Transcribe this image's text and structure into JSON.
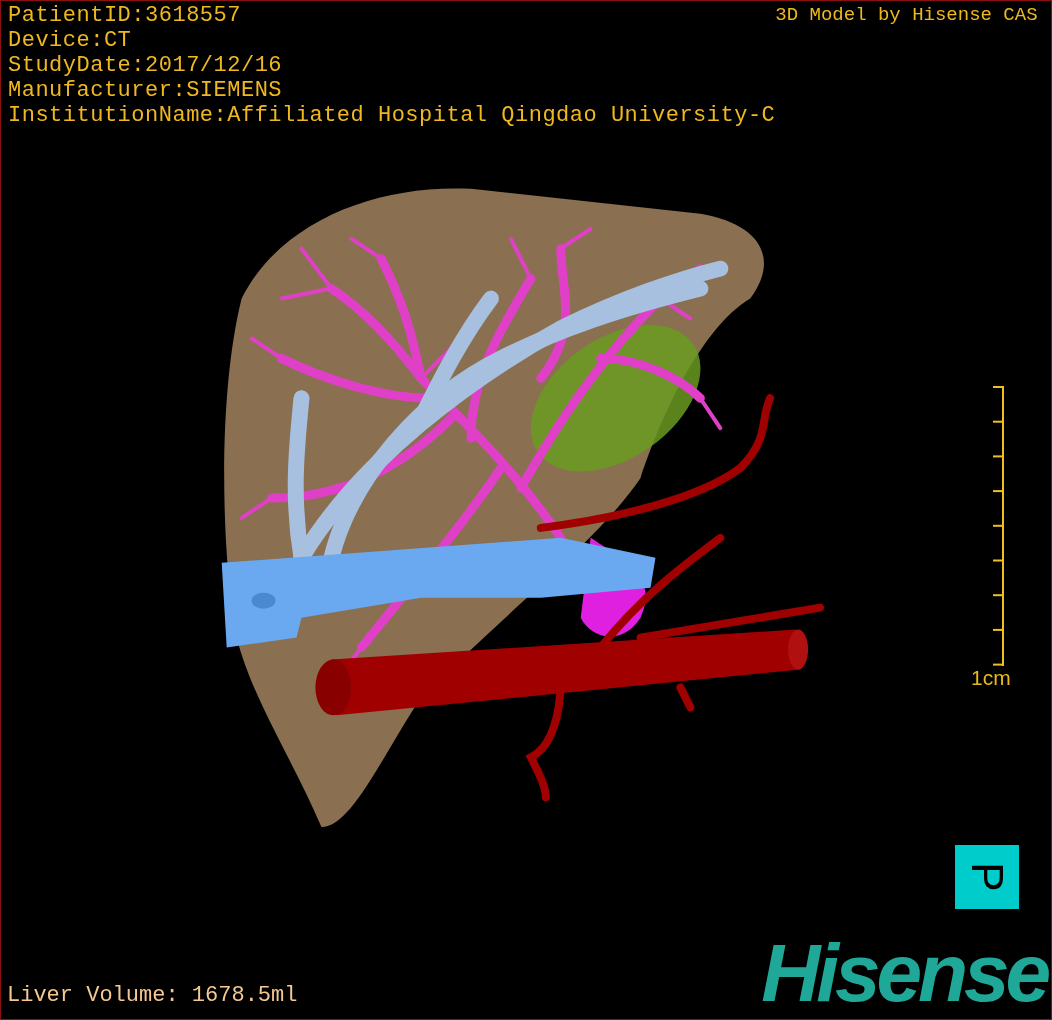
{
  "header": {
    "lines": [
      "PatientID:3618557",
      "Device:CT",
      "StudyDate:2017/12/16",
      "Manufacturer:SIEMENS",
      "InstitutionName:Affiliated Hospital Qingdao University-C"
    ],
    "credit": "3D Model by Hisense CAS"
  },
  "scale_bar": {
    "label": "1cm"
  },
  "orientation_marker": {
    "label": "P"
  },
  "footer": {
    "measurement": "Liver Volume: 1678.5ml",
    "logo": "Hisense"
  }
}
